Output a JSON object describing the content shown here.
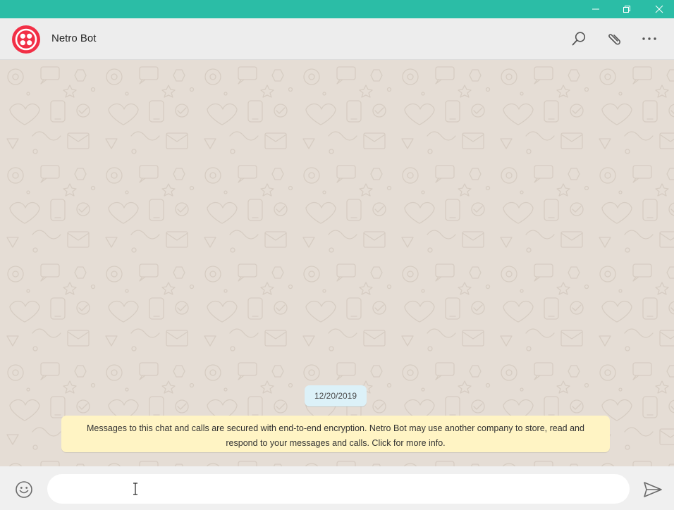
{
  "window": {
    "accent_color": "#2bbda6",
    "controls": [
      "minimize-icon",
      "restore-icon",
      "close-icon"
    ]
  },
  "header": {
    "contact_name": "Netro Bot",
    "avatar_color": "#f22f46",
    "actions": [
      "search-icon",
      "paperclip-icon",
      "more-options-icon"
    ]
  },
  "chat": {
    "background_color": "#e5ddd5",
    "date_label": "12/20/2019",
    "encryption_notice": "Messages to this chat and calls are secured with end-to-end encryption. Netro Bot may use another company to store, read and respond to your messages and calls. Click for more info."
  },
  "composer": {
    "message_value": "",
    "emoji_icon": "emoji-icon",
    "send_icon": "send-icon"
  }
}
